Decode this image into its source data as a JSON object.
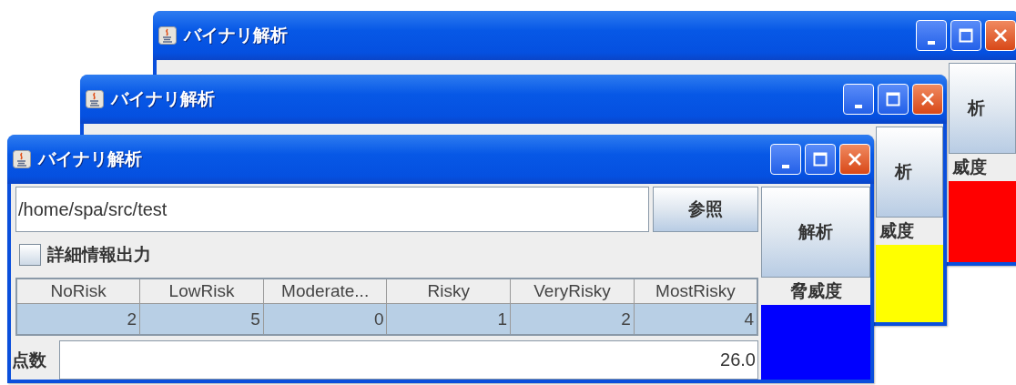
{
  "windows": [
    {
      "kind": "partial",
      "title": "バイナリ解析",
      "analyze_button": "析",
      "threat_label": "威度",
      "threat": {
        "color": "#ff0000"
      }
    },
    {
      "kind": "partial",
      "title": "バイナリ解析",
      "analyze_button": "析",
      "threat_label": "威度",
      "threat": {
        "color": "#ffff00"
      }
    },
    {
      "kind": "full",
      "title": "バイナリ解析",
      "path_field": {
        "value": "/home/spa/src/test"
      },
      "browse_button": "参照",
      "analyze_button": "解析",
      "verbose_checkbox": {
        "label": "詳細情報出力",
        "checked": false
      },
      "table": {
        "columns": [
          "NoRisk",
          "LowRisk",
          "Moderate...",
          "Risky",
          "VeryRisky",
          "MostRisky"
        ],
        "rows": [
          {
            "selected": true,
            "cells": [
              "2",
              "5",
              "0",
              "1",
              "2",
              "4"
            ]
          }
        ]
      },
      "score": {
        "label": "点数",
        "value": "26.0"
      },
      "threat_label": "脅威度",
      "threat": {
        "color": "#0000ff"
      }
    }
  ]
}
